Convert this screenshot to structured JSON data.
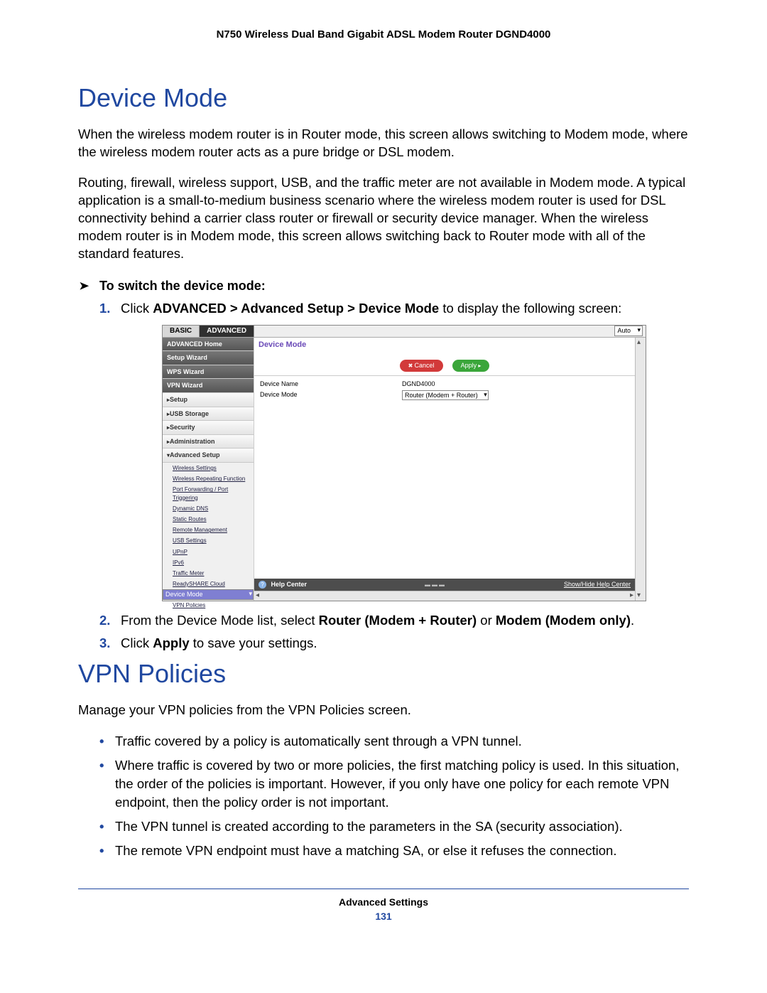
{
  "header": "N750 Wireless Dual Band Gigabit ADSL Modem Router DGND4000",
  "section1": {
    "title": "Device Mode",
    "p1": "When the wireless modem router is in Router mode, this screen allows switching to Modem mode, where the wireless modem router acts as a pure bridge or DSL modem.",
    "p2": "Routing, firewall, wireless support, USB, and the traffic meter are not available in Modem mode. A typical application is a small-to-medium business scenario where the wireless modem router is used for DSL connectivity behind a carrier class router or firewall or security device manager. When the wireless modem router is in Modem mode, this screen allows switching back to Router mode with all of the standard features.",
    "proc_head": "To switch the device mode:",
    "step1_a": "Click ",
    "step1_b": "ADVANCED > Advanced Setup > Device Mode",
    "step1_c": " to display the following screen:",
    "step2_a": "From the Device Mode list, select ",
    "step2_b": "Router (Modem + Router)",
    "step2_c": " or ",
    "step2_d": "Modem (Modem only)",
    "step2_e": ".",
    "step3_a": "Click ",
    "step3_b": "Apply",
    "step3_c": " to save your settings."
  },
  "shot": {
    "tab_basic": "BASIC",
    "tab_adv": "ADVANCED",
    "auto": "Auto",
    "sidebar": {
      "home": "ADVANCED Home",
      "setupwiz": "Setup Wizard",
      "wps": "WPS Wizard",
      "vpnwiz": "VPN Wizard",
      "setup": "Setup",
      "usb": "USB Storage",
      "security": "Security",
      "admin": "Administration",
      "advsetup": "Advanced Setup",
      "sub": {
        "ws": "Wireless Settings",
        "wrf": "Wireless Repeating Function",
        "pf": "Port Forwarding / Port Triggering",
        "ddns": "Dynamic DNS",
        "sr": "Static Routes",
        "rm": "Remote Management",
        "usbs": "USB Settings",
        "upnp": "UPnP",
        "ipv6": "IPv6",
        "tm": "Traffic Meter",
        "rsc": "ReadySHARE Cloud",
        "dm": "Device Mode",
        "vp": "VPN Policies"
      }
    },
    "pane_title": "Device Mode",
    "btn_cancel": "Cancel",
    "btn_apply": "Apply",
    "lbl_name": "Device Name",
    "val_name": "DGND4000",
    "lbl_mode": "Device Mode",
    "val_mode": "Router (Modem + Router)",
    "help": "Help Center",
    "help_link": "Show/Hide Help Center"
  },
  "section2": {
    "title": "VPN Policies",
    "p1": "Manage your VPN policies from the VPN Policies screen.",
    "b1": "Traffic covered by a policy is automatically sent through a VPN tunnel.",
    "b2": "Where traffic is covered by two or more policies, the first matching policy is used. In this situation, the order of the policies is important. However, if you only have one policy for each remote VPN endpoint, then the policy order is not important.",
    "b3": "The VPN tunnel is created according to the parameters in the SA (security association).",
    "b4": "The remote VPN endpoint must have a matching SA, or else it refuses the connection."
  },
  "footer": {
    "section": "Advanced Settings",
    "page": "131"
  }
}
